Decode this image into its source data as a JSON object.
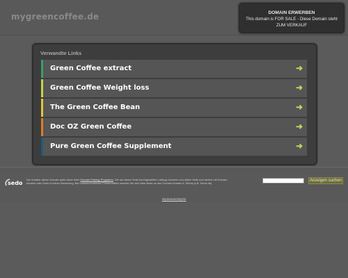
{
  "header": {
    "domain": "mygreencoffee.de",
    "sale": {
      "title": "DOMAIN ERWERBEN",
      "line1": "This domain is FOR SALE - Diese Domain steht",
      "line2": "ZUM VERKAUF"
    }
  },
  "links": {
    "heading": "Verwandte Links",
    "items": [
      {
        "label": "Green Coffee extract",
        "accent": "#3d9c6f",
        "arrow_color": "#bcd75a",
        "arrow": "➜"
      },
      {
        "label": "Green Coffee Weight loss",
        "accent": "#c8d44a",
        "arrow_color": "#bcd75a",
        "arrow": "➜"
      },
      {
        "label": "The Green Coffee Bean",
        "accent": "#e3c43a",
        "arrow_color": "#bcd75a",
        "arrow": "➜"
      },
      {
        "label": "Doc OZ Green Coffee",
        "accent": "#e07b2a",
        "arrow_color": "#bcd75a",
        "arrow": "➜"
      },
      {
        "label": "Pure Green Coffee Supplement",
        "accent": "#1f5a7a",
        "arrow_color": "#bcd75a",
        "arrow": "➜"
      }
    ]
  },
  "footer": {
    "logo_text": "sedo",
    "text_part1": "Der Inhaber dieser Domain parkt diese beim ",
    "text_link": "Domain-Parking-Programm",
    "text_part2": ". Die auf dieser Seite bereitgestellten Listings kommen von dritter Seite und stehen mit Domain-Inhaber oder Sedo in keiner Beziehung. Bei markenrechtlichen Problemfällen wenden Sie sich bitte direkt an den Domain-Inhaber lt. Whois (s.B. Denic.de).",
    "search_placeholder": "",
    "search_button": "Anzeigen suchen",
    "imprint": "Impressum/Imprint"
  }
}
